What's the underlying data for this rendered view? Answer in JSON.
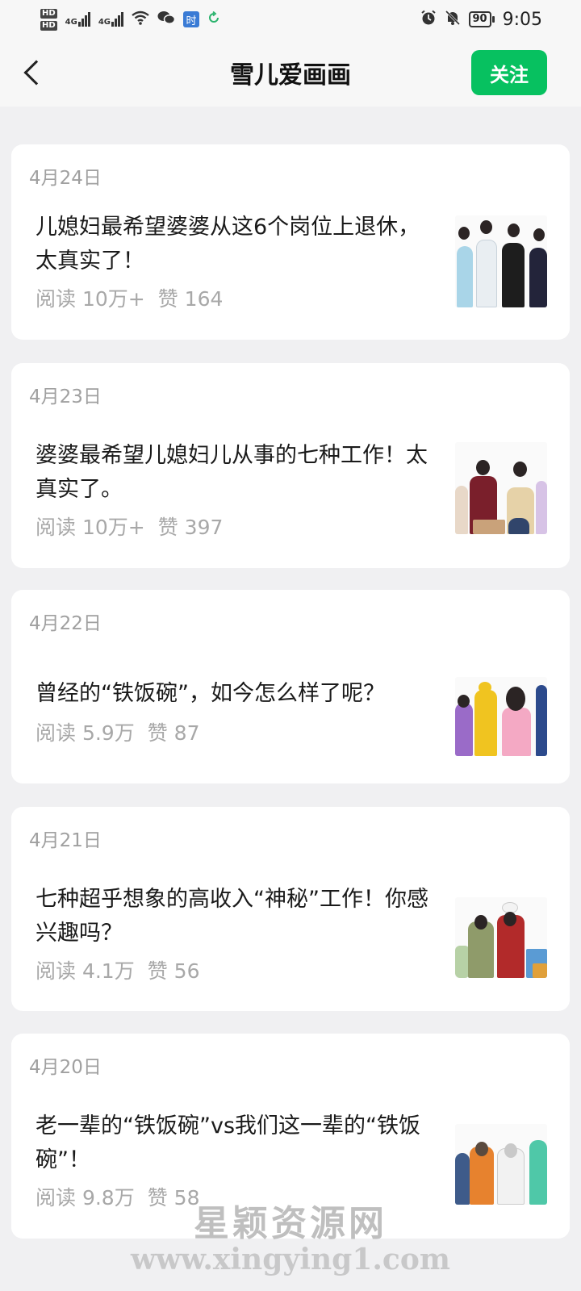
{
  "status_bar": {
    "hd1": "HD",
    "hd2": "HD",
    "net1": "4G",
    "net2": "4G",
    "app_tile": "时",
    "battery": "90",
    "time": "9:05"
  },
  "header": {
    "title": "雪儿爱画画",
    "follow_label": "关注"
  },
  "articles": [
    {
      "date": "4月24日",
      "title": "儿媳妇最希望婆婆从这6个岗位上退休，太真实了！",
      "reads": "阅读 10万+",
      "likes": "赞 164"
    },
    {
      "date": "4月23日",
      "title": "婆婆最希望儿媳妇儿从事的七种工作！太真实了。",
      "reads": "阅读 10万+",
      "likes": "赞 397"
    },
    {
      "date": "4月22日",
      "title": "曾经的“铁饭碗”，如今怎么样了呢？",
      "reads": "阅读 5.9万",
      "likes": "赞 87"
    },
    {
      "date": "4月21日",
      "title": "七种超乎想象的高收入“神秘”工作！你感兴趣吗？",
      "reads": "阅读 4.1万",
      "likes": "赞 56"
    },
    {
      "date": "4月20日",
      "title": "老一辈的“铁饭碗”vs我们这一辈的“铁饭碗”！",
      "reads": "阅读 9.8万",
      "likes": "赞 58"
    }
  ],
  "watermark": {
    "text": "星颖资源网",
    "url": "www.xingying1.com"
  },
  "colors": {
    "accent": "#07c160",
    "background": "#f0f0f2",
    "meta_text": "#a8a8a8"
  },
  "icons": [
    "back-icon",
    "wifi-icon",
    "wechat-icon",
    "alarm-icon",
    "mute-bell-icon",
    "battery-icon"
  ]
}
